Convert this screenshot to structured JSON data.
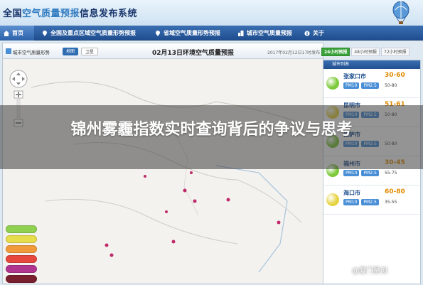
{
  "app": {
    "title_prefix": "全国",
    "title_highlight": "空气质量预报",
    "title_suffix": "信息发布系统"
  },
  "nav": {
    "items": [
      {
        "label": "首页",
        "icon": "home-icon"
      },
      {
        "label": "全国及重点区域空气质量形势预报",
        "icon": "location-icon"
      },
      {
        "label": "省域空气质量形势预报",
        "icon": "location-icon"
      },
      {
        "label": "城市空气质量预报",
        "icon": "city-icon"
      },
      {
        "label": "关于",
        "icon": "info-icon"
      }
    ]
  },
  "map": {
    "toolbar_label": "城市空气质量形势",
    "btn_map": "地图",
    "btn_satellite": "卫星",
    "heading": "02月13日环境空气质量预报",
    "timestamp": "2017年02月12日17时发布"
  },
  "forecast_tabs": [
    "24小时预报",
    "48小时预报",
    "72小时预报"
  ],
  "side": {
    "header": "城市列表",
    "cities": [
      {
        "name": "张家口市",
        "range": "30-60",
        "range_color": "#e08a00",
        "dot_color": "#7dc93a",
        "chips": [
          "PM10",
          "PM2.5"
        ],
        "chip_range": "50-80"
      },
      {
        "name": "昆明市",
        "range": "51-61",
        "range_color": "#e08a00",
        "dot_color": "#e6d342",
        "chips": [
          "PM10",
          "PM2.5"
        ],
        "chip_range": "50-80"
      },
      {
        "name": "拉萨市",
        "range": "",
        "range_color": "#e08a00",
        "dot_color": "#7dc93a",
        "chips": [
          "PM10",
          "PM2.5"
        ],
        "chip_range": "50-80"
      },
      {
        "name": "福州市",
        "range": "30-45",
        "range_color": "#e08a00",
        "dot_color": "#7dc93a",
        "chips": [
          "PM10",
          "PM2.5"
        ],
        "chip_range": "55-75"
      },
      {
        "name": "海口市",
        "range": "60-80",
        "range_color": "#e08a00",
        "dot_color": "#e6d342",
        "chips": [
          "PM10",
          "PM2.5"
        ],
        "chip_range": "35-55"
      }
    ]
  },
  "banner": {
    "text": "锦州雾霾指数实时查询背后的争议与思考"
  },
  "legend": {
    "colors": [
      "#8fd14f",
      "#e7dd4a",
      "#f19a3a",
      "#e6483e",
      "#b0358f",
      "#7a1f2f"
    ]
  },
  "watermark": "@厦门星创"
}
